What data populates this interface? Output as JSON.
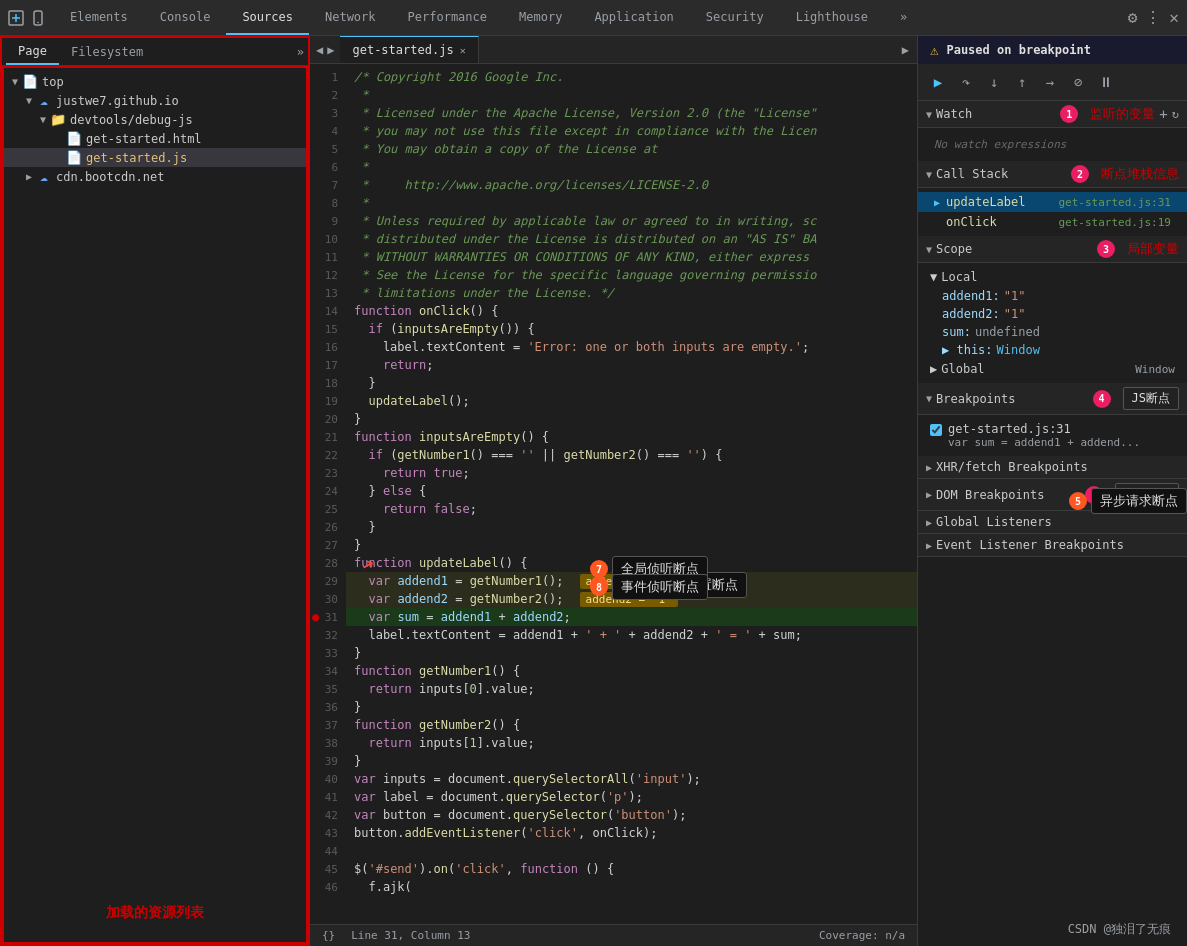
{
  "tabs": {
    "items": [
      {
        "label": "Elements",
        "active": false
      },
      {
        "label": "Console",
        "active": false
      },
      {
        "label": "Sources",
        "active": true
      },
      {
        "label": "Network",
        "active": false
      },
      {
        "label": "Performance",
        "active": false
      },
      {
        "label": "Memory",
        "active": false
      },
      {
        "label": "Application",
        "active": false
      },
      {
        "label": "Security",
        "active": false
      },
      {
        "label": "Lighthouse",
        "active": false
      }
    ]
  },
  "panel_tabs": {
    "page": "Page",
    "filesystem": "Filesystem"
  },
  "file_tree": {
    "annotation": "加载的资源列表",
    "items": [
      {
        "indent": 0,
        "arrow": "▼",
        "icon": "📄",
        "label": "top",
        "type": "folder"
      },
      {
        "indent": 1,
        "arrow": "▼",
        "icon": "☁",
        "label": "justwe7.github.io",
        "type": "folder"
      },
      {
        "indent": 2,
        "arrow": "▼",
        "icon": "📁",
        "label": "devtools/debug-js",
        "type": "folder"
      },
      {
        "indent": 3,
        "arrow": "",
        "icon": "📄",
        "label": "get-started.html",
        "type": "html"
      },
      {
        "indent": 3,
        "arrow": "",
        "icon": "📄",
        "label": "get-started.js",
        "type": "js",
        "selected": true
      },
      {
        "indent": 1,
        "arrow": "▶",
        "icon": "☁",
        "label": "cdn.bootcdn.net",
        "type": "folder"
      }
    ]
  },
  "editor": {
    "filename": "get-started.js",
    "lines": [
      {
        "n": 1,
        "code": "/* Copyright 2016 Google Inc.",
        "style": "comment"
      },
      {
        "n": 2,
        "code": " *",
        "style": "comment"
      },
      {
        "n": 3,
        "code": " * Licensed under the Apache License, Version 2.0 (the \"License\"",
        "style": "comment"
      },
      {
        "n": 4,
        "code": " * you may not use this file except in compliance with the Licen",
        "style": "comment"
      },
      {
        "n": 5,
        "code": " * You may obtain a copy of the License at",
        "style": "comment"
      },
      {
        "n": 6,
        "code": " *",
        "style": "comment"
      },
      {
        "n": 7,
        "code": " *     http://www.apache.org/licenses/LICENSE-2.0",
        "style": "comment"
      },
      {
        "n": 8,
        "code": " *",
        "style": "comment"
      },
      {
        "n": 9,
        "code": " * Unless required by applicable law or agreed to in writing, sc",
        "style": "comment"
      },
      {
        "n": 10,
        "code": " * distributed under the License is distributed on an \"AS IS\" BA",
        "style": "comment"
      },
      {
        "n": 11,
        "code": " * WITHOUT WARRANTIES OR CONDITIONS OF ANY KIND, either express",
        "style": "comment"
      },
      {
        "n": 12,
        "code": " * See the License for the specific language governing permissio",
        "style": "comment"
      },
      {
        "n": 13,
        "code": " * limitations under the License. */",
        "style": "comment"
      },
      {
        "n": 14,
        "code": "function onClick() {",
        "style": "normal"
      },
      {
        "n": 15,
        "code": "  if (inputsAreEmpty()) {",
        "style": "normal"
      },
      {
        "n": 16,
        "code": "    label.textContent = 'Error: one or both inputs are empty.';",
        "style": "normal"
      },
      {
        "n": 17,
        "code": "    return;",
        "style": "normal"
      },
      {
        "n": 18,
        "code": "  }",
        "style": "normal"
      },
      {
        "n": 19,
        "code": "  updateLabel();",
        "style": "normal"
      },
      {
        "n": 20,
        "code": "}",
        "style": "normal"
      },
      {
        "n": 21,
        "code": "function inputsAreEmpty() {",
        "style": "normal"
      },
      {
        "n": 22,
        "code": "  if (getNumber1() === '' || getNumber2() === '') {",
        "style": "normal"
      },
      {
        "n": 23,
        "code": "    return true;",
        "style": "normal"
      },
      {
        "n": 24,
        "code": "  } else {",
        "style": "normal"
      },
      {
        "n": 25,
        "code": "    return false;",
        "style": "normal"
      },
      {
        "n": 26,
        "code": "  }",
        "style": "normal"
      },
      {
        "n": 27,
        "code": "}",
        "style": "normal"
      },
      {
        "n": 28,
        "code": "function updateLabel() {",
        "style": "normal"
      },
      {
        "n": 29,
        "code": "  var addend1 = getNumber1();    addend1 = \"1\"",
        "style": "var-highlight"
      },
      {
        "n": 30,
        "code": "  var addend2 = getNumber2();    addend2 = \"1\"",
        "style": "var-highlight"
      },
      {
        "n": 31,
        "code": "  var sum = addend1 + addend2;",
        "style": "active-breakpoint"
      },
      {
        "n": 32,
        "code": "  label.textContent = addend1 + ' + ' + addend2 + ' = ' + sum;",
        "style": "normal"
      },
      {
        "n": 33,
        "code": "}",
        "style": "normal"
      },
      {
        "n": 34,
        "code": "function getNumber1() {",
        "style": "normal"
      },
      {
        "n": 35,
        "code": "  return inputs[0].value;",
        "style": "normal"
      },
      {
        "n": 36,
        "code": "}",
        "style": "normal"
      },
      {
        "n": 37,
        "code": "function getNumber2() {",
        "style": "normal"
      },
      {
        "n": 38,
        "code": "  return inputs[1].value;",
        "style": "normal"
      },
      {
        "n": 39,
        "code": "}",
        "style": "normal"
      },
      {
        "n": 40,
        "code": "var inputs = document.querySelectorAll('input');",
        "style": "normal"
      },
      {
        "n": 41,
        "code": "var label = document.querySelector('p');",
        "style": "normal"
      },
      {
        "n": 42,
        "code": "var button = document.querySelector('button');",
        "style": "normal"
      },
      {
        "n": 43,
        "code": "button.addEventListener('click', onClick);",
        "style": "normal"
      },
      {
        "n": 44,
        "code": "",
        "style": "normal"
      },
      {
        "n": 45,
        "code": "$('#send').on('click', function () {",
        "style": "normal"
      },
      {
        "n": 46,
        "code": "  f.ajk(",
        "style": "normal"
      }
    ],
    "status": {
      "line": "Line 31, Column 13",
      "coverage": "Coverage: n/a"
    }
  },
  "debugger": {
    "paused_label": "Paused on breakpoint",
    "watch": {
      "title": "Watch",
      "badge": "1",
      "empty_text": "No watch expressions",
      "add_btn": "+",
      "refresh_btn": "↻"
    },
    "watch_ann": "监听的变量",
    "callstack": {
      "title": "Call Stack",
      "badge": "2",
      "items": [
        {
          "name": "updateLabel",
          "file": "get-started.js:31",
          "active": true
        },
        {
          "name": "onClick",
          "file": "get-started.js:19",
          "active": false
        }
      ]
    },
    "callstack_ann": "断点堆栈信息",
    "scope": {
      "title": "Scope",
      "badge": "3",
      "ann": "局部变量",
      "local": {
        "title": "Local",
        "vars": [
          {
            "name": "addend1:",
            "value": "\"1\""
          },
          {
            "name": "addend2:",
            "value": "\"1\""
          },
          {
            "name": "sum:",
            "value": "undefined"
          },
          {
            "name": "▶ this:",
            "value": "Window"
          }
        ]
      },
      "global": {
        "title": "Global",
        "value": "Window"
      }
    },
    "breakpoints": {
      "title": "Breakpoints",
      "badge": "4",
      "ann": "JS断点",
      "items": [
        {
          "file": "get-started.js:31",
          "code": "var sum = addend1 + addend...",
          "checked": true
        }
      ]
    },
    "xhr_breakpoints": {
      "title": "XHR/fetch Breakpoints",
      "badge": "5",
      "ann": "异步请求断点"
    },
    "dom_breakpoints": {
      "title": "DOM Breakpoints",
      "badge": "6",
      "ann": "DOM断点"
    },
    "global_listeners": {
      "title": "Global Listeners",
      "badge": "7",
      "ann": "全局侦听断点"
    },
    "event_listeners": {
      "title": "Event Listener Breakpoints",
      "badge": "8",
      "ann": "事件侦听断点"
    }
  },
  "annotations": {
    "file_tree": "加载的资源列表",
    "click_line": "点击某一行设置断点",
    "async": "异步请求断点",
    "global_listen": "全局侦听断点",
    "event_listen": "事件侦听断点"
  },
  "footer": {
    "csdn": "CSDN @独泪了无痕"
  }
}
